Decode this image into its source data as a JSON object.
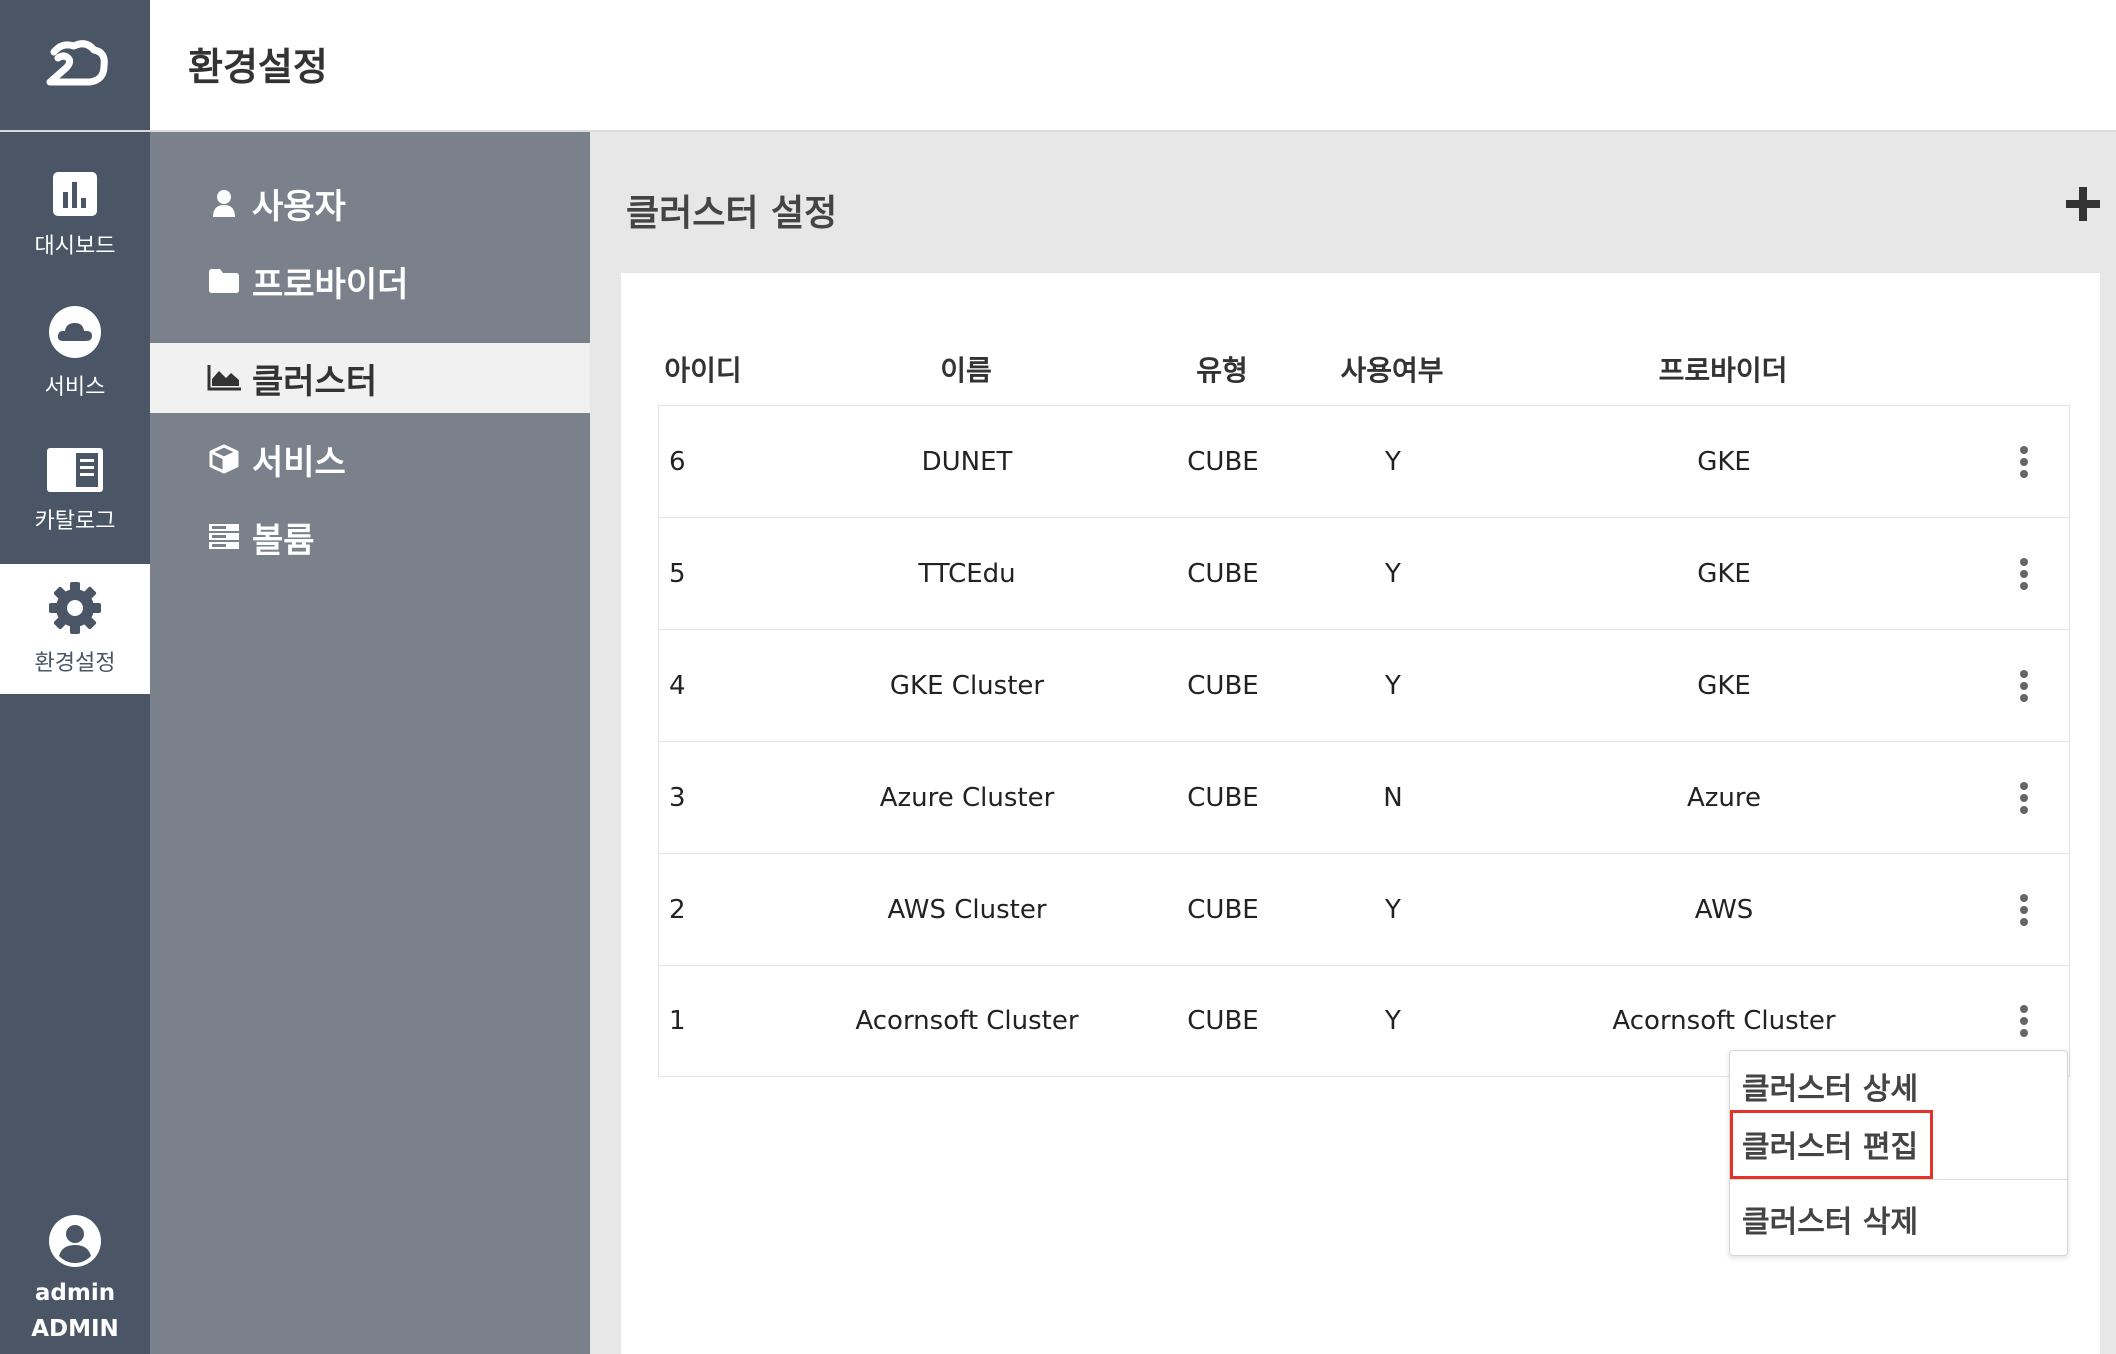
{
  "rail": {
    "items": [
      {
        "label": "대시보드",
        "icon": "bar-chart-icon"
      },
      {
        "label": "서비스",
        "icon": "cloud-icon"
      },
      {
        "label": "카탈로그",
        "icon": "catalog-icon"
      },
      {
        "label": "환경설정",
        "icon": "gear-icon",
        "active": true
      }
    ],
    "user": {
      "name": "admin",
      "role": "ADMIN",
      "icon": "user-circle-icon"
    }
  },
  "header": {
    "title": "환경설정"
  },
  "submenu": {
    "items": [
      {
        "label": "사용자",
        "icon": "user-icon"
      },
      {
        "label": "프로바이더",
        "icon": "folder-icon"
      },
      {
        "label": "클러스터",
        "icon": "area-chart-icon",
        "active": true
      },
      {
        "label": "서비스",
        "icon": "cube-icon"
      },
      {
        "label": "볼륨",
        "icon": "server-icon"
      }
    ]
  },
  "main": {
    "section_title": "클러스터 설정",
    "add_icon": "plus-icon",
    "table": {
      "headers": [
        "아이디",
        "이름",
        "유형",
        "사용여부",
        "프로바이더"
      ],
      "rows": [
        {
          "id": "6",
          "name": "DUNET",
          "type": "CUBE",
          "enabled": "Y",
          "provider": "GKE"
        },
        {
          "id": "5",
          "name": "TTCEdu",
          "type": "CUBE",
          "enabled": "Y",
          "provider": "GKE"
        },
        {
          "id": "4",
          "name": "GKE Cluster",
          "type": "CUBE",
          "enabled": "Y",
          "provider": "GKE"
        },
        {
          "id": "3",
          "name": "Azure Cluster",
          "type": "CUBE",
          "enabled": "N",
          "provider": "Azure"
        },
        {
          "id": "2",
          "name": "AWS Cluster",
          "type": "CUBE",
          "enabled": "Y",
          "provider": "AWS"
        },
        {
          "id": "1",
          "name": "Acornsoft Cluster",
          "type": "CUBE",
          "enabled": "Y",
          "provider": "Acornsoft Cluster"
        }
      ]
    },
    "dropdown": {
      "items": [
        "클러스터 상세",
        "클러스터 편집",
        "클러스터 삭제"
      ],
      "highlight_color": "#e53228"
    }
  },
  "colors": {
    "rail": "#4a5565",
    "submenu": "#7a818b",
    "background": "#e7e7e7"
  }
}
